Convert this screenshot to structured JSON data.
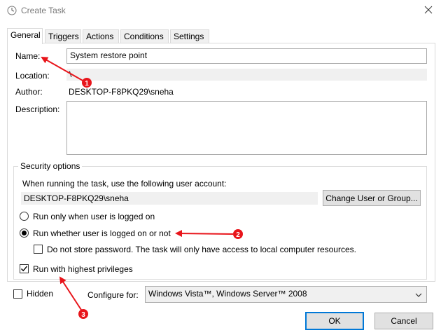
{
  "window": {
    "title": "Create Task",
    "icon": "task-scheduler-clock-icon"
  },
  "tabs": [
    {
      "label": "General",
      "active": true
    },
    {
      "label": "Triggers",
      "active": false
    },
    {
      "label": "Actions",
      "active": false
    },
    {
      "label": "Conditions",
      "active": false
    },
    {
      "label": "Settings",
      "active": false
    }
  ],
  "general": {
    "name_label": "Name:",
    "name_value": "System restore point",
    "location_label": "Location:",
    "location_value": "\\",
    "author_label": "Author:",
    "author_value": "DESKTOP-F8PKQ29\\sneha",
    "description_label": "Description:",
    "description_value": ""
  },
  "security": {
    "group_title": "Security options",
    "account_prompt": "When running the task, use the following user account:",
    "account_value": "DESKTOP-F8PKQ29\\sneha",
    "change_user_button": "Change User or Group...",
    "radio_logged_on": "Run only when user is logged on",
    "radio_whether": "Run whether user is logged on or not",
    "selected_radio": "whether",
    "no_store_password": "Do not store password.  The task will only have access to local computer resources.",
    "no_store_password_checked": false,
    "highest_privileges": "Run with highest privileges",
    "highest_privileges_checked": true
  },
  "footer": {
    "hidden_label": "Hidden",
    "hidden_checked": false,
    "configure_label": "Configure for:",
    "configure_value": "Windows Vista™, Windows Server™ 2008",
    "ok_button": "OK",
    "cancel_button": "Cancel"
  },
  "annotations": {
    "color": "#e8151b",
    "markers": [
      "1",
      "2",
      "3"
    ]
  }
}
